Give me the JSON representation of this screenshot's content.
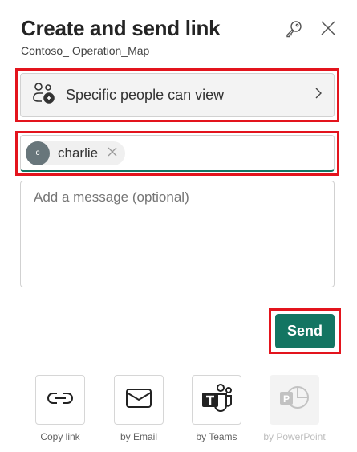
{
  "header": {
    "title": "Create and send link",
    "subtitle": "Contoso_ Operation_Map"
  },
  "permission": {
    "label": "Specific people can view"
  },
  "recipients": [
    {
      "initial": "c",
      "name": "charlie"
    }
  ],
  "message": {
    "placeholder": "Add a message (optional)",
    "value": ""
  },
  "send_label": "Send",
  "share_options": [
    {
      "label": "Copy link",
      "enabled": true
    },
    {
      "label": "by Email",
      "enabled": true
    },
    {
      "label": "by Teams",
      "enabled": true
    },
    {
      "label": "by PowerPoint",
      "enabled": false
    }
  ],
  "colors": {
    "accent": "#137562",
    "highlight": "#e3141d"
  }
}
